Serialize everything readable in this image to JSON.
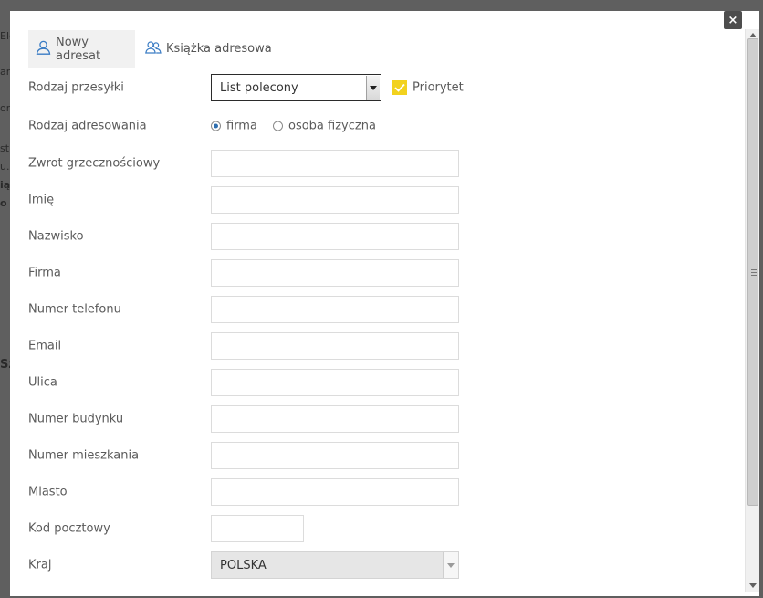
{
  "background": {
    "fragments": [
      "Ele",
      "are",
      "or",
      "st",
      "u.",
      "iąż",
      "o",
      "Sz"
    ]
  },
  "modal": {
    "close_label": "×",
    "tabs": [
      {
        "label": "Nowy adresat",
        "icon": "person-icon",
        "active": true
      },
      {
        "label": "Książka adresowa",
        "icon": "contacts-icon",
        "active": false
      }
    ],
    "shipment_type": {
      "label": "Rodzaj przesyłki",
      "value": "List polecony"
    },
    "priority": {
      "label": "Priorytet",
      "checked": true
    },
    "addressing": {
      "label": "Rodzaj adresowania",
      "options": [
        {
          "label": "firma",
          "checked": true
        },
        {
          "label": "osoba fizyczna",
          "checked": false
        }
      ]
    },
    "fields": {
      "salutation": {
        "label": "Zwrot grzecznościowy",
        "value": ""
      },
      "first_name": {
        "label": "Imię",
        "value": ""
      },
      "last_name": {
        "label": "Nazwisko",
        "value": ""
      },
      "company": {
        "label": "Firma",
        "value": ""
      },
      "phone": {
        "label": "Numer telefonu",
        "value": ""
      },
      "email": {
        "label": "Email",
        "value": ""
      },
      "street": {
        "label": "Ulica",
        "value": ""
      },
      "building": {
        "label": "Numer budynku",
        "value": ""
      },
      "apartment": {
        "label": "Numer mieszkania",
        "value": ""
      },
      "city": {
        "label": "Miasto",
        "value": ""
      },
      "postal_code": {
        "label": "Kod pocztowy",
        "value": ""
      }
    },
    "country": {
      "label": "Kraj",
      "value": "POLSKA"
    }
  },
  "colors": {
    "overlay": "#5f5f5f",
    "checkbox": "#f2d21e",
    "icon_blue": "#3a7cc4",
    "radio_accent": "#2f6fb0"
  }
}
